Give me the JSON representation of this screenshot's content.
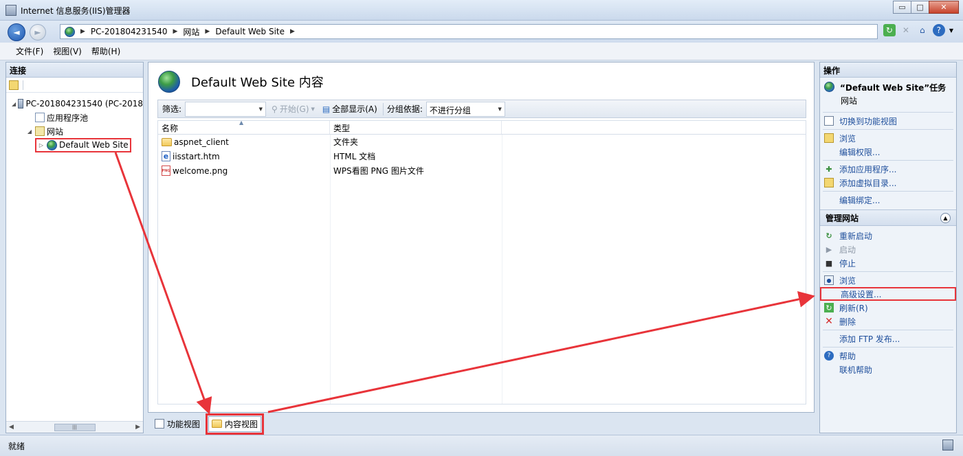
{
  "window": {
    "title": "Internet 信息服务(IIS)管理器",
    "minimize": "▭",
    "maximize": "□",
    "close": "✕"
  },
  "nav": {
    "back": "◄",
    "forward": "►",
    "breadcrumb": [
      "PC-201804231540",
      "网站",
      "Default Web Site"
    ]
  },
  "menu": [
    "文件(F)",
    "视图(V)",
    "帮助(H)"
  ],
  "connections": {
    "title": "连接",
    "tree": [
      {
        "label": "PC-201804231540 (PC-2018",
        "icon": "server-icon",
        "expander": "◢"
      },
      {
        "label": "应用程序池",
        "icon": "app-pool-icon",
        "expander": ""
      },
      {
        "label": "网站",
        "icon": "sites-folder-icon",
        "expander": "◢"
      },
      {
        "label": "Default Web Site",
        "icon": "globe-icon",
        "expander": "▷"
      }
    ]
  },
  "content": {
    "title": "Default Web Site 内容",
    "filter_label": "筛选:",
    "start_label": "开始(G)",
    "show_all_label": "全部显示(A)",
    "group_label": "分组依据:",
    "group_value": "不进行分组",
    "columns": [
      "名称",
      "类型"
    ],
    "rows": [
      {
        "name": "aspnet_client",
        "type": "文件夹",
        "icon": "folder-icon"
      },
      {
        "name": "iisstart.htm",
        "type": "HTML 文档",
        "icon": "html-file-icon"
      },
      {
        "name": "welcome.png",
        "type": "WPS看图 PNG 图片文件",
        "icon": "png-file-icon"
      }
    ]
  },
  "view_tabs": {
    "features": "功能视图",
    "content": "内容视图"
  },
  "actions": {
    "title": "操作",
    "task_title": "“Default Web Site”任务",
    "task_sub": "网站",
    "group1": [
      {
        "label": "切换到功能视图",
        "icon": "features-view-icon"
      }
    ],
    "group2": [
      {
        "label": "浏览",
        "icon": "explore-icon"
      },
      {
        "label": "编辑权限...",
        "icon": ""
      }
    ],
    "group3": [
      {
        "label": "添加应用程序...",
        "icon": "add-app-icon"
      },
      {
        "label": "添加虚拟目录...",
        "icon": "add-vdir-icon"
      }
    ],
    "group4": [
      {
        "label": "编辑绑定...",
        "icon": ""
      }
    ],
    "manage_title": "管理网站",
    "manage": [
      {
        "label": "重新启动",
        "icon": "restart-icon",
        "muted": false
      },
      {
        "label": "启动",
        "icon": "start-icon",
        "muted": true
      },
      {
        "label": "停止",
        "icon": "stop-icon",
        "muted": false
      }
    ],
    "browse": "浏览",
    "advanced": "高级设置...",
    "refresh": "刷新(R)",
    "delete": "删除",
    "ftp": "添加 FTP 发布...",
    "help": "帮助",
    "online_help": "联机帮助"
  },
  "status": {
    "text": "就绪"
  },
  "colors": {
    "highlight": "#e8343a",
    "link": "#1f4f9c"
  }
}
